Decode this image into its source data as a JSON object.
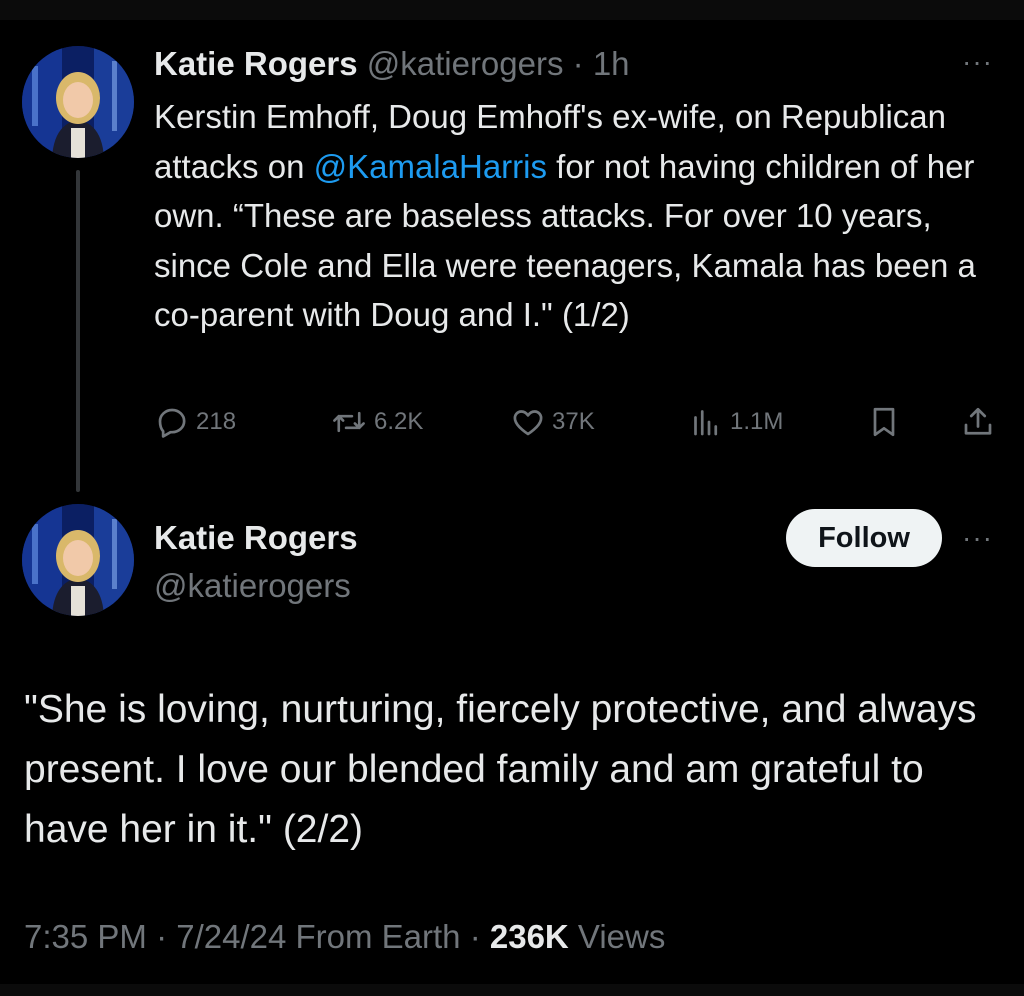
{
  "tweet1": {
    "name": "Katie Rogers",
    "handle": "@katierogers",
    "time": "· 1h",
    "text_before_mention": "Kerstin Emhoff, Doug Emhoff's ex-wife, on Republican attacks on ",
    "mention": "@KamalaHarris",
    "text_after_mention": "  for not having children of her own. “These are baseless attacks. For over 10 years, since Cole and Ella were teenagers, Kamala has been a co-parent with Doug and I.\" (1/2)",
    "more_label": "···",
    "actions": {
      "replies": "218",
      "reposts": "6.2K",
      "likes": "37K",
      "views": "1.1M"
    },
    "icons": [
      "reply-icon",
      "repost-icon",
      "like-icon",
      "views-icon",
      "bookmark-icon",
      "share-icon"
    ]
  },
  "tweet2": {
    "name": "Katie Rogers",
    "handle": "@katierogers",
    "follow_label": "Follow",
    "more_label": "···",
    "text": "\"She is loving, nurturing, fiercely protective, and always present. I love our blended family and am grateful to have her in it.\" (2/2)",
    "timestamp": "7:35 PM · 7/24/24 From Earth · ",
    "views_count": "236K",
    "views_label": " Views"
  },
  "colors": {
    "background": "#000000",
    "text": "#e7e9ea",
    "secondary": "#71767b",
    "accent": "#1d9bf0",
    "follow_bg": "#eff3f4"
  }
}
